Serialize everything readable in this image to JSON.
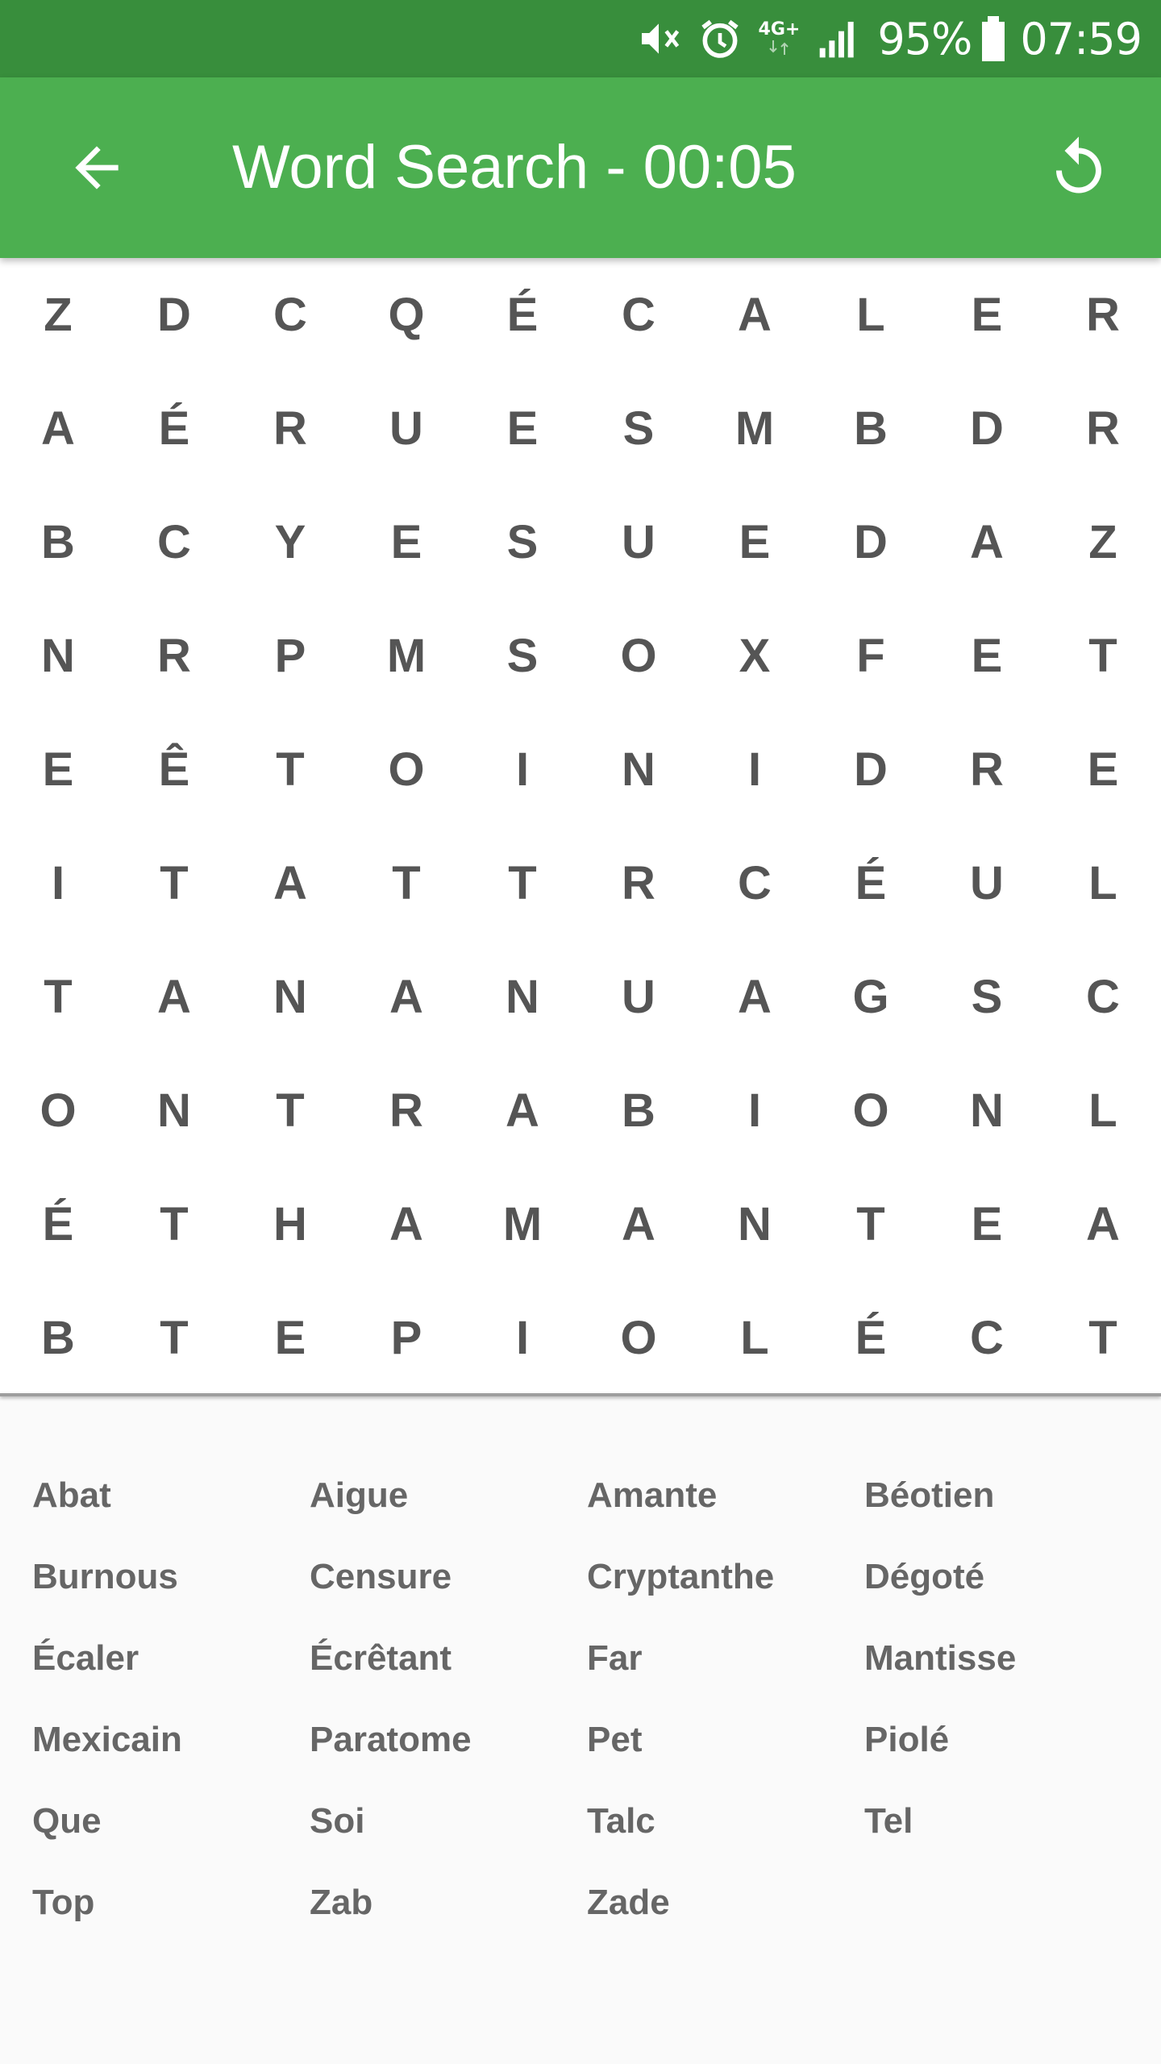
{
  "status_bar": {
    "battery_percent": "95%",
    "time": "07:59",
    "network_label": "4G+",
    "icons": [
      "mute-vibrate-icon",
      "alarm-icon",
      "network-4g-icon",
      "signal-icon",
      "battery-icon"
    ]
  },
  "app_bar": {
    "title": "Word Search - 00:05",
    "back_icon": "arrow-back-icon",
    "refresh_icon": "refresh-icon",
    "background_color": "#4caf50",
    "status_color": "#388e3c"
  },
  "grid": {
    "rows": [
      [
        "Z",
        "D",
        "C",
        "Q",
        "É",
        "C",
        "A",
        "L",
        "E",
        "R"
      ],
      [
        "A",
        "É",
        "R",
        "U",
        "E",
        "S",
        "M",
        "B",
        "D",
        "R"
      ],
      [
        "B",
        "C",
        "Y",
        "E",
        "S",
        "U",
        "E",
        "D",
        "A",
        "Z"
      ],
      [
        "N",
        "R",
        "P",
        "M",
        "S",
        "O",
        "X",
        "F",
        "E",
        "T"
      ],
      [
        "E",
        "Ê",
        "T",
        "O",
        "I",
        "N",
        "I",
        "D",
        "R",
        "E"
      ],
      [
        "I",
        "T",
        "A",
        "T",
        "T",
        "R",
        "C",
        "É",
        "U",
        "L"
      ],
      [
        "T",
        "A",
        "N",
        "A",
        "N",
        "U",
        "A",
        "G",
        "S",
        "C"
      ],
      [
        "O",
        "N",
        "T",
        "R",
        "A",
        "B",
        "I",
        "O",
        "N",
        "L"
      ],
      [
        "É",
        "T",
        "H",
        "A",
        "M",
        "A",
        "N",
        "T",
        "E",
        "A"
      ],
      [
        "B",
        "T",
        "E",
        "P",
        "I",
        "O",
        "L",
        "É",
        "C",
        "T"
      ]
    ]
  },
  "words": [
    "Abat",
    "Aigue",
    "Amante",
    "Béotien",
    "Burnous",
    "Censure",
    "Cryptanthe",
    "Dégoté",
    "Écaler",
    "Écrêtant",
    "Far",
    "Mantisse",
    "Mexicain",
    "Paratome",
    "Pet",
    "Piolé",
    "Que",
    "Soi",
    "Talc",
    "Tel",
    "Top",
    "Zab",
    "Zade"
  ]
}
